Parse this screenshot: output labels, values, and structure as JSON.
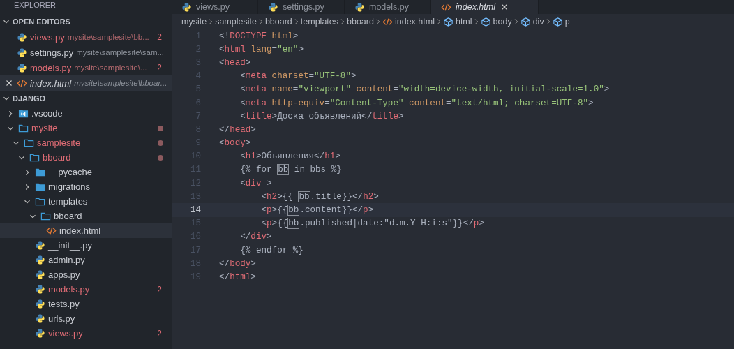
{
  "sidebar": {
    "title": "EXPLORER",
    "open_editors": {
      "title": "OPEN EDITORS",
      "expanded": true,
      "items": [
        {
          "kind": "python",
          "name": "views.py",
          "path": "mysite\\samplesite\\bb...",
          "badge": "2",
          "modified": true,
          "selected": false,
          "preview": false
        },
        {
          "kind": "python",
          "name": "settings.py",
          "path": "mysite\\samplesite\\sam...",
          "modified": false,
          "selected": false,
          "preview": false
        },
        {
          "kind": "python",
          "name": "models.py",
          "path": "mysite\\samplesite\\...",
          "badge": "2",
          "modified": true,
          "selected": false,
          "preview": false
        },
        {
          "kind": "html",
          "name": "index.html",
          "path": "mysite\\samplesite\\bboar...",
          "modified": false,
          "selected": true,
          "preview": true
        }
      ]
    },
    "project": {
      "title": "DJANGO",
      "expanded": true,
      "tree": [
        {
          "kind": "vscode",
          "name": ".vscode",
          "expanded": false,
          "modified": false,
          "selected": false
        },
        {
          "kind": "folder",
          "name": "mysite",
          "expanded": true,
          "modified": true,
          "selected": false,
          "children": [
            {
              "kind": "folder",
              "name": "samplesite",
              "expanded": true,
              "modified": true,
              "selected": false,
              "children": [
                {
                  "kind": "folder",
                  "name": "bboard",
                  "expanded": true,
                  "modified": true,
                  "selected": false,
                  "children": [
                    {
                      "kind": "filled-folder",
                      "name": "__pycache__",
                      "expanded": false,
                      "modified": false,
                      "selected": false
                    },
                    {
                      "kind": "filled-folder",
                      "name": "migrations",
                      "expanded": false,
                      "modified": false,
                      "selected": false
                    },
                    {
                      "kind": "folder",
                      "name": "templates",
                      "expanded": true,
                      "modified": false,
                      "selected": false,
                      "children": [
                        {
                          "kind": "folder",
                          "name": "bboard",
                          "expanded": true,
                          "modified": false,
                          "selected": false,
                          "children": [
                            {
                              "kind": "html",
                              "name": "index.html",
                              "modified": false,
                              "selected": true
                            }
                          ]
                        }
                      ]
                    },
                    {
                      "kind": "python",
                      "name": "__init__.py",
                      "modified": false,
                      "selected": false
                    },
                    {
                      "kind": "python",
                      "name": "admin.py",
                      "modified": false,
                      "selected": false
                    },
                    {
                      "kind": "python",
                      "name": "apps.py",
                      "modified": false,
                      "selected": false
                    },
                    {
                      "kind": "python",
                      "name": "models.py",
                      "modified": true,
                      "badge": "2",
                      "selected": false
                    },
                    {
                      "kind": "python",
                      "name": "tests.py",
                      "modified": false,
                      "selected": false
                    },
                    {
                      "kind": "python",
                      "name": "urls.py",
                      "modified": false,
                      "selected": false
                    },
                    {
                      "kind": "python",
                      "name": "views.py",
                      "modified": true,
                      "badge": "2",
                      "selected": false
                    }
                  ]
                }
              ]
            }
          ]
        }
      ]
    }
  },
  "tabs": [
    {
      "kind": "python",
      "label": "views.py",
      "selected": false,
      "preview": false
    },
    {
      "kind": "python",
      "label": "settings.py",
      "selected": false,
      "preview": false
    },
    {
      "kind": "python",
      "label": "models.py",
      "selected": false,
      "preview": false
    },
    {
      "kind": "html",
      "label": "index.html",
      "selected": true,
      "preview": true
    }
  ],
  "breadcrumbs": [
    {
      "kind": "folder",
      "text": "mysite"
    },
    {
      "kind": "folder",
      "text": "samplesite"
    },
    {
      "kind": "folder",
      "text": "bboard"
    },
    {
      "kind": "folder",
      "text": "templates"
    },
    {
      "kind": "folder",
      "text": "bboard"
    },
    {
      "kind": "html",
      "text": "index.html"
    },
    {
      "kind": "symbol",
      "text": "html"
    },
    {
      "kind": "symbol",
      "text": "body"
    },
    {
      "kind": "symbol",
      "text": "div"
    },
    {
      "kind": "symbol",
      "text": "p"
    }
  ],
  "editor": {
    "lines": [
      {
        "number": "1",
        "current": false,
        "tokens": [
          {
            "kind": "punct",
            "text": "<!"
          },
          {
            "kind": "tag",
            "text": "DOCTYPE"
          },
          {
            "kind": "attr",
            "text": " html"
          },
          {
            "kind": "punct",
            "text": ">"
          }
        ]
      },
      {
        "number": "2",
        "current": false,
        "tokens": [
          {
            "kind": "punct",
            "text": "<"
          },
          {
            "kind": "tag",
            "text": "html"
          },
          {
            "kind": "attr",
            "text": " lang"
          },
          {
            "kind": "punct",
            "text": "="
          },
          {
            "kind": "string",
            "text": "\"en\""
          },
          {
            "kind": "punct",
            "text": ">"
          }
        ]
      },
      {
        "number": "3",
        "current": false,
        "tokens": [
          {
            "kind": "punct",
            "text": "<"
          },
          {
            "kind": "tag",
            "text": "head"
          },
          {
            "kind": "punct",
            "text": ">"
          }
        ]
      },
      {
        "number": "4",
        "current": false,
        "tokens": [
          {
            "kind": "punct",
            "text": "    <"
          },
          {
            "kind": "tag",
            "text": "meta"
          },
          {
            "kind": "attr",
            "text": " charset"
          },
          {
            "kind": "punct",
            "text": "="
          },
          {
            "kind": "string",
            "text": "\"UTF-8\""
          },
          {
            "kind": "punct",
            "text": ">"
          }
        ]
      },
      {
        "number": "5",
        "current": false,
        "tokens": [
          {
            "kind": "punct",
            "text": "    <"
          },
          {
            "kind": "tag",
            "text": "meta"
          },
          {
            "kind": "attr",
            "text": " name"
          },
          {
            "kind": "punct",
            "text": "="
          },
          {
            "kind": "string",
            "text": "\"viewport\""
          },
          {
            "kind": "attr",
            "text": " content"
          },
          {
            "kind": "punct",
            "text": "="
          },
          {
            "kind": "string",
            "text": "\"width=device-width, initial-scale=1.0\""
          },
          {
            "kind": "punct",
            "text": ">"
          }
        ]
      },
      {
        "number": "6",
        "current": false,
        "tokens": [
          {
            "kind": "punct",
            "text": "    <"
          },
          {
            "kind": "tag",
            "text": "meta"
          },
          {
            "kind": "attr",
            "text": " http-equiv"
          },
          {
            "kind": "punct",
            "text": "="
          },
          {
            "kind": "string",
            "text": "\"Content-Type\""
          },
          {
            "kind": "attr",
            "text": " content"
          },
          {
            "kind": "punct",
            "text": "="
          },
          {
            "kind": "string",
            "text": "\"text/html; charset=UTF-8\""
          },
          {
            "kind": "punct",
            "text": ">"
          }
        ]
      },
      {
        "number": "7",
        "current": false,
        "tokens": [
          {
            "kind": "punct",
            "text": "    <"
          },
          {
            "kind": "tag",
            "text": "title"
          },
          {
            "kind": "punct",
            "text": ">"
          },
          {
            "kind": "text",
            "text": "Доска объявлений"
          },
          {
            "kind": "punct",
            "text": "</"
          },
          {
            "kind": "tag",
            "text": "title"
          },
          {
            "kind": "punct",
            "text": ">"
          }
        ]
      },
      {
        "number": "8",
        "current": false,
        "tokens": [
          {
            "kind": "punct",
            "text": "</"
          },
          {
            "kind": "tag",
            "text": "head"
          },
          {
            "kind": "punct",
            "text": ">"
          }
        ]
      },
      {
        "number": "9",
        "current": false,
        "tokens": [
          {
            "kind": "punct",
            "text": "<"
          },
          {
            "kind": "tag",
            "text": "body"
          },
          {
            "kind": "punct",
            "text": ">"
          }
        ]
      },
      {
        "number": "10",
        "current": false,
        "tokens": [
          {
            "kind": "punct",
            "text": "    <"
          },
          {
            "kind": "tag",
            "text": "h1"
          },
          {
            "kind": "punct",
            "text": ">"
          },
          {
            "kind": "text",
            "text": "Объявления"
          },
          {
            "kind": "punct",
            "text": "</"
          },
          {
            "kind": "tag",
            "text": "h1"
          },
          {
            "kind": "punct",
            "text": ">"
          }
        ]
      },
      {
        "number": "11",
        "current": false,
        "tokens": [
          {
            "kind": "text",
            "text": "    {% for "
          },
          {
            "kind": "match",
            "text": "bb"
          },
          {
            "kind": "text",
            "text": " in bbs %}"
          }
        ]
      },
      {
        "number": "12",
        "current": false,
        "tokens": [
          {
            "kind": "punct",
            "text": "    <"
          },
          {
            "kind": "tag",
            "text": "div"
          },
          {
            "kind": "punct",
            "text": " >"
          }
        ]
      },
      {
        "number": "13",
        "current": false,
        "tokens": [
          {
            "kind": "punct",
            "text": "        <"
          },
          {
            "kind": "tag",
            "text": "h2"
          },
          {
            "kind": "punct",
            "text": ">"
          },
          {
            "kind": "text",
            "text": "{{ "
          },
          {
            "kind": "match",
            "text": "bb"
          },
          {
            "kind": "text",
            "text": ".title}}"
          },
          {
            "kind": "punct",
            "text": "</"
          },
          {
            "kind": "tag",
            "text": "h2"
          },
          {
            "kind": "punct",
            "text": ">"
          }
        ]
      },
      {
        "number": "14",
        "current": true,
        "tokens": [
          {
            "kind": "punct",
            "text": "        <"
          },
          {
            "kind": "tag",
            "text": "p"
          },
          {
            "kind": "punct",
            "text": ">"
          },
          {
            "kind": "text",
            "text": "{{"
          },
          {
            "kind": "match",
            "text": "bb"
          },
          {
            "kind": "text",
            "text": ".content}}"
          },
          {
            "kind": "punct",
            "text": "</"
          },
          {
            "kind": "tag",
            "text": "p"
          },
          {
            "kind": "punct",
            "text": ">"
          }
        ]
      },
      {
        "number": "15",
        "current": false,
        "tokens": [
          {
            "kind": "punct",
            "text": "        <"
          },
          {
            "kind": "tag",
            "text": "p"
          },
          {
            "kind": "punct",
            "text": ">"
          },
          {
            "kind": "text",
            "text": "{{"
          },
          {
            "kind": "match",
            "text": "bb"
          },
          {
            "kind": "text",
            "text": ".published|date:\"d.m.Y H:i:s\"}}"
          },
          {
            "kind": "punct",
            "text": "</"
          },
          {
            "kind": "tag",
            "text": "p"
          },
          {
            "kind": "punct",
            "text": ">"
          }
        ]
      },
      {
        "number": "16",
        "current": false,
        "tokens": [
          {
            "kind": "punct",
            "text": "    </"
          },
          {
            "kind": "tag",
            "text": "div"
          },
          {
            "kind": "punct",
            "text": ">"
          }
        ]
      },
      {
        "number": "17",
        "current": false,
        "tokens": [
          {
            "kind": "text",
            "text": "    {% endfor %}"
          }
        ]
      },
      {
        "number": "18",
        "current": false,
        "tokens": [
          {
            "kind": "punct",
            "text": "</"
          },
          {
            "kind": "tag",
            "text": "body"
          },
          {
            "kind": "punct",
            "text": ">"
          }
        ]
      },
      {
        "number": "19",
        "current": false,
        "tokens": [
          {
            "kind": "punct",
            "text": "</"
          },
          {
            "kind": "tag",
            "text": "html"
          },
          {
            "kind": "punct",
            "text": ">"
          }
        ]
      }
    ]
  }
}
